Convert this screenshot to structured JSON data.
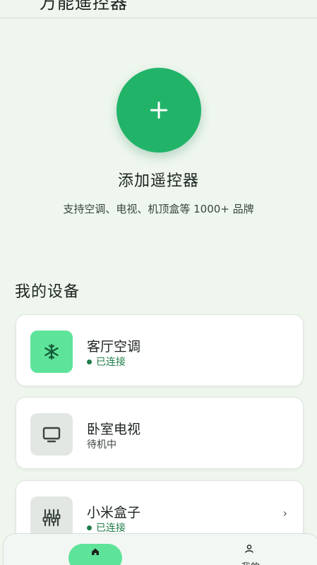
{
  "header": {
    "title": "万能遥控器"
  },
  "add": {
    "icon": "plus-icon",
    "title": "添加遥控器",
    "subtitle": "支持空调、电视、机顶盒等 1000+ 品牌"
  },
  "devices": {
    "section_title": "我的设备",
    "items": [
      {
        "name": "客厅空调",
        "status": "已连接",
        "connected": true,
        "icon": "snowflake-icon"
      },
      {
        "name": "卧室电视",
        "status": "待机中",
        "connected": false,
        "icon": "tv-icon"
      },
      {
        "name": "小米盒子",
        "status": "已连接",
        "connected": true,
        "icon": "sliders-icon",
        "chevron": "›"
      }
    ]
  },
  "nav": {
    "home_label": "首页",
    "mine_label": "我的"
  },
  "colors": {
    "accent": "#21b468",
    "accent_light": "#5ee39a",
    "connected": "#1f7d49",
    "background": "#eef6ee"
  }
}
